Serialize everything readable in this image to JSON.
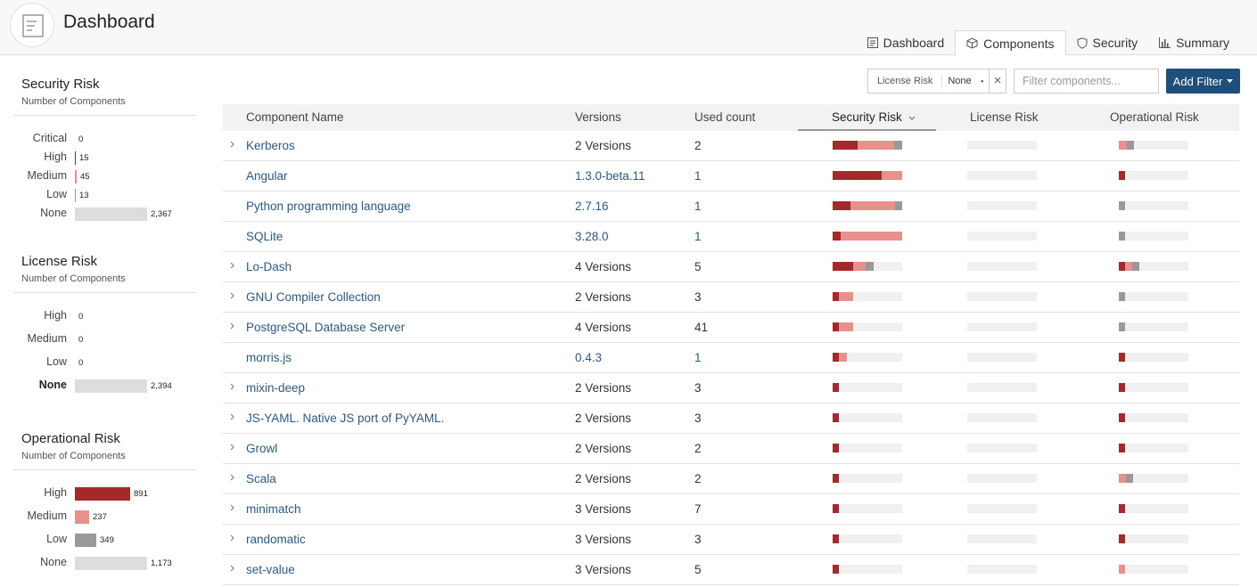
{
  "header": {
    "title": "Dashboard",
    "tabs": [
      {
        "label": "Dashboard",
        "icon": "dashboard-icon",
        "active": false
      },
      {
        "label": "Components",
        "icon": "cube-icon",
        "active": true
      },
      {
        "label": "Security",
        "icon": "shield-icon",
        "active": false
      },
      {
        "label": "Summary",
        "icon": "bar-chart-icon",
        "active": false
      }
    ]
  },
  "colors": {
    "critical": "#8b1a1a",
    "high": "#a5282b",
    "medium": "#e8908c",
    "low": "#999999",
    "none": "#dddddd",
    "accent": "#1e4e7c",
    "link": "#2a5a87"
  },
  "sidebar": {
    "security": {
      "title": "Security Risk",
      "subtitle": "Number of Components",
      "rows": [
        {
          "label": "Critical",
          "count": "0",
          "value": 0,
          "level": "critical"
        },
        {
          "label": "High",
          "count": "15",
          "value": 15,
          "level": "high"
        },
        {
          "label": "Medium",
          "count": "45",
          "value": 45,
          "level": "medium"
        },
        {
          "label": "Low",
          "count": "13",
          "value": 13,
          "level": "low"
        },
        {
          "label": "None",
          "count": "2,367",
          "value": 2367,
          "level": "none"
        }
      ]
    },
    "license": {
      "title": "License Risk",
      "subtitle": "Number of Components",
      "rows": [
        {
          "label": "High",
          "count": "0",
          "value": 0,
          "level": "high"
        },
        {
          "label": "Medium",
          "count": "0",
          "value": 0,
          "level": "medium"
        },
        {
          "label": "Low",
          "count": "0",
          "value": 0,
          "level": "low"
        },
        {
          "label": "None",
          "count": "2,394",
          "value": 2394,
          "level": "none",
          "bold": true
        }
      ]
    },
    "operational": {
      "title": "Operational Risk",
      "subtitle": "Number of Components",
      "rows": [
        {
          "label": "High",
          "count": "891",
          "value": 891,
          "level": "high"
        },
        {
          "label": "Medium",
          "count": "237",
          "value": 237,
          "level": "medium"
        },
        {
          "label": "Low",
          "count": "349",
          "value": 349,
          "level": "low"
        },
        {
          "label": "None",
          "count": "1,173",
          "value": 1173,
          "level": "none"
        }
      ]
    }
  },
  "toolbar": {
    "filter_name": "License Risk",
    "filter_value": "None",
    "search_placeholder": "Filter components...",
    "add_filter_label": "Add Filter"
  },
  "table": {
    "columns": {
      "name": "Component Name",
      "versions": "Versions",
      "used": "Used count",
      "security": "Security Risk",
      "license": "License Risk",
      "operational": "Operational Risk"
    },
    "rows": [
      {
        "name": "Kerberos",
        "versions": "2 Versions",
        "used": "2",
        "expandable": true,
        "sec": [
          0.36,
          0.52,
          0.12
        ],
        "op": [
          0,
          0.12,
          0.1
        ]
      },
      {
        "name": "Angular",
        "versions": "1.3.0-beta.11",
        "used": "1",
        "expandable": false,
        "sec": [
          0.7,
          0.3,
          0
        ],
        "op": [
          0.09,
          0,
          0
        ]
      },
      {
        "name": "Python programming language",
        "versions": "2.7.16",
        "used": "1",
        "expandable": false,
        "sec": [
          0.25,
          0.65,
          0.1
        ],
        "op": [
          0,
          0,
          0.09
        ]
      },
      {
        "name": "SQLite",
        "versions": "3.28.0",
        "used": "1",
        "expandable": false,
        "sec": [
          0.12,
          0.88,
          0
        ],
        "op": [
          0,
          0,
          0.09
        ]
      },
      {
        "name": "Lo-Dash",
        "versions": "4 Versions",
        "used": "5",
        "expandable": true,
        "sec": [
          0.3,
          0.18,
          0.12
        ],
        "op": [
          0.09,
          0.1,
          0.1
        ]
      },
      {
        "name": "GNU Compiler Collection",
        "versions": "2 Versions",
        "used": "3",
        "expandable": true,
        "sec": [
          0.09,
          0.21,
          0
        ],
        "op": [
          0,
          0,
          0.09
        ]
      },
      {
        "name": "PostgreSQL Database Server",
        "versions": "4 Versions",
        "used": "41",
        "expandable": true,
        "sec": [
          0.09,
          0.21,
          0
        ],
        "op": [
          0,
          0,
          0.09
        ]
      },
      {
        "name": "morris.js",
        "versions": "0.4.3",
        "used": "1",
        "expandable": false,
        "sec": [
          0.09,
          0.12,
          0
        ],
        "op": [
          0.09,
          0,
          0
        ]
      },
      {
        "name": "mixin-deep",
        "versions": "2 Versions",
        "used": "3",
        "expandable": true,
        "sec": [
          0.09,
          0,
          0
        ],
        "op": [
          0.09,
          0,
          0
        ]
      },
      {
        "name": "JS-YAML. Native JS port of PyYAML.",
        "versions": "2 Versions",
        "used": "3",
        "expandable": true,
        "sec": [
          0.09,
          0,
          0
        ],
        "op": [
          0.09,
          0,
          0
        ]
      },
      {
        "name": "Growl",
        "versions": "2 Versions",
        "used": "2",
        "expandable": true,
        "sec": [
          0.09,
          0,
          0
        ],
        "op": [
          0.09,
          0,
          0
        ]
      },
      {
        "name": "Scala",
        "versions": "2 Versions",
        "used": "2",
        "expandable": true,
        "sec": [
          0.09,
          0,
          0
        ],
        "op": [
          0,
          0.1,
          0.1
        ]
      },
      {
        "name": "minimatch",
        "versions": "3 Versions",
        "used": "7",
        "expandable": true,
        "sec": [
          0.09,
          0,
          0
        ],
        "op": [
          0.09,
          0,
          0
        ]
      },
      {
        "name": "randomatic",
        "versions": "3 Versions",
        "used": "3",
        "expandable": true,
        "sec": [
          0.09,
          0,
          0
        ],
        "op": [
          0.09,
          0,
          0
        ]
      },
      {
        "name": "set-value",
        "versions": "3 Versions",
        "used": "5",
        "expandable": true,
        "sec": [
          0.09,
          0,
          0
        ],
        "op": [
          0,
          0.09,
          0
        ]
      }
    ]
  }
}
